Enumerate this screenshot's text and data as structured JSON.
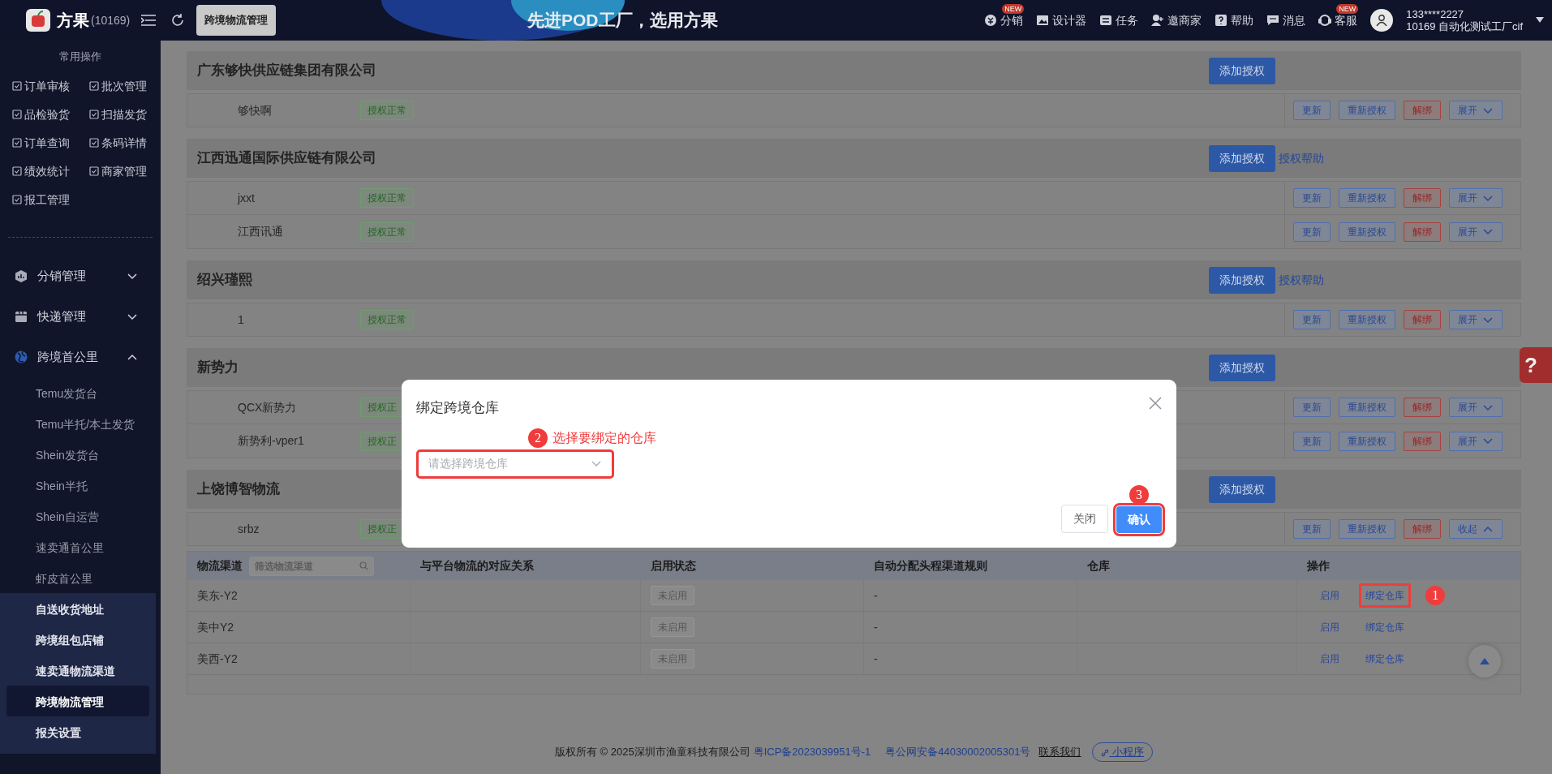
{
  "topbar": {
    "brand": "方果",
    "shop_id": "(10169)",
    "tab": "跨境物流管理",
    "slogan": "先进POD工厂，选用方果",
    "menu": [
      {
        "label": "分销",
        "badge": "NEW"
      },
      {
        "label": "设计器"
      },
      {
        "label": "任务"
      },
      {
        "label": "邀商家"
      },
      {
        "label": "帮助"
      },
      {
        "label": "消息"
      },
      {
        "label": "客服",
        "badge": "NEW"
      }
    ],
    "user": {
      "phone": "133****2227",
      "company": "10169 自动化测试工厂cif"
    }
  },
  "sidebar": {
    "quick_title": "常用操作",
    "quick_ops": [
      "订单审核",
      "批次管理",
      "品检验货",
      "扫描发货",
      "订单查询",
      "条码详情",
      "绩效统计",
      "商家管理",
      "报工管理"
    ],
    "menu": [
      {
        "label": "分销管理",
        "expanded": false
      },
      {
        "label": "快递管理",
        "expanded": false
      },
      {
        "label": "跨境首公里",
        "expanded": true,
        "children": [
          "Temu发货台",
          "Temu半托/本土发货",
          "Shein发货台",
          "Shein半托",
          "Shein自运营",
          "速卖通首公里",
          "虾皮首公里"
        ]
      }
    ],
    "panel_items": [
      {
        "label": "自送收货地址",
        "selected": false
      },
      {
        "label": "跨境组包店铺",
        "selected": false
      },
      {
        "label": "速卖通物流渠道",
        "selected": false
      },
      {
        "label": "跨境物流管理",
        "selected": true
      },
      {
        "label": "报关设置",
        "selected": false
      }
    ]
  },
  "auth_groups": [
    {
      "company": "广东够快供应链集团有限公司",
      "add_button": "添加授权",
      "accounts": [
        {
          "name": "够快啊",
          "status": "授权正常",
          "actions": [
            "更新",
            "重新授权",
            "解绑"
          ],
          "toggle": "展开",
          "expanded": false
        }
      ]
    },
    {
      "company": "江西迅通国际供应链有限公司",
      "add_button": "添加授权",
      "help_link": "授权帮助",
      "accounts": [
        {
          "name": "jxxt",
          "status": "授权正常",
          "actions": [
            "更新",
            "重新授权",
            "解绑"
          ],
          "toggle": "展开",
          "expanded": false
        },
        {
          "name": "江西讯通",
          "status": "授权正常",
          "actions": [
            "更新",
            "重新授权",
            "解绑"
          ],
          "toggle": "展开",
          "expanded": false
        }
      ]
    },
    {
      "company": "绍兴瑾熙",
      "add_button": "添加授权",
      "help_link": "授权帮助",
      "accounts": [
        {
          "name": "1",
          "status": "授权正常",
          "actions": [
            "更新",
            "重新授权",
            "解绑"
          ],
          "toggle": "展开",
          "expanded": false
        }
      ]
    },
    {
      "company": "新势力",
      "add_button": "添加授权",
      "accounts": [
        {
          "name": "QCX新势力",
          "status": "授权正",
          "actions": [
            "更新",
            "重新授权",
            "解绑"
          ],
          "toggle": "展开",
          "expanded": false
        },
        {
          "name": "新势利-vper1",
          "status": "授权正",
          "actions": [
            "更新",
            "重新授权",
            "解绑"
          ],
          "toggle": "展开",
          "expanded": false
        }
      ]
    },
    {
      "company": "上饶博智物流",
      "add_button": "添加授权",
      "accounts": [
        {
          "name": "srbz",
          "status": "授权正",
          "actions": [
            "更新",
            "重新授权",
            "解绑"
          ],
          "toggle": "收起",
          "expanded": true
        }
      ]
    }
  ],
  "channel_table": {
    "filter_placeholder": "筛选物流渠道",
    "columns": [
      "物流渠道",
      "与平台物流的对应关系",
      "启用状态",
      "自动分配头程渠道规则",
      "仓库",
      "操作"
    ],
    "rows": [
      {
        "channel": "美东-Y2",
        "status": "未启用",
        "rule": "-",
        "actions": [
          "启用",
          "绑定仓库"
        ],
        "highlighted": true,
        "step": "1"
      },
      {
        "channel": "美中Y2",
        "status": "未启用",
        "rule": "-",
        "actions": [
          "启用",
          "绑定仓库"
        ],
        "highlighted": false
      },
      {
        "channel": "美西-Y2",
        "status": "未启用",
        "rule": "-",
        "actions": [
          "启用",
          "绑定仓库"
        ],
        "highlighted": false
      }
    ]
  },
  "modal": {
    "title": "绑定跨境仓库",
    "hint": {
      "step": "2",
      "text": "选择要绑定的仓库"
    },
    "select_placeholder": "请选择跨境仓库",
    "buttons": [
      {
        "label": "关闭",
        "kind": "secondary"
      },
      {
        "label": "确认",
        "kind": "primary",
        "step": "3"
      }
    ]
  },
  "float_help": "?",
  "footer": {
    "copyright": "版权所有 © 2025深圳市渔童科技有限公司",
    "icp": "粤ICP备2023039951号-1",
    "police": "粤公网安备44030002005301号",
    "contact": "联系我们",
    "mini_program": "小程序"
  }
}
